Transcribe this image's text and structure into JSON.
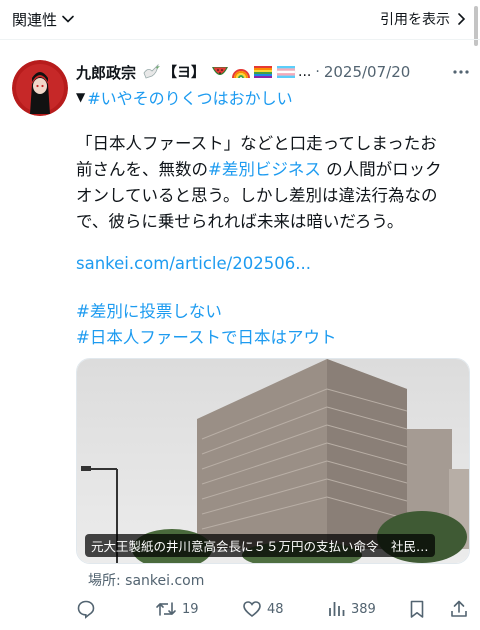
{
  "top_bar": {
    "sort_label": "関連性",
    "view_quotes_label": "引用を表示"
  },
  "tweet": {
    "author_name": "九郎政宗",
    "badge_text": "【ヨ】",
    "name_truncation": "...",
    "date_separator": "·",
    "date": "2025/07/20",
    "bio_marker": "▼",
    "bio_hashtag": "#いやそのりくつはおかしい",
    "body_before": "「日本人ファースト」などと口走ってしまったお\n前さんを、無数の",
    "body_hashtag": "#差別ビジネス",
    "body_after": " の人間がロック\nオンしていると思う。しかし差別は違法行為なの\nで、彼らに乗せられれば未来は暗いだろう。",
    "link": "sankei.com/article/202506...",
    "tag_line_1": "#差別に投票しない",
    "tag_line_2": "#日本人ファーストで日本はアウト",
    "card_caption": "元大王製紙の井川意高会長に５５万円の支払い命令　社民…",
    "card_source": "場所: sankei.com"
  },
  "actions": {
    "retweets": "19",
    "likes": "48",
    "views": "389"
  },
  "icons": {
    "sort": "chevron-down-icon",
    "view_quotes": "chevron-right-icon",
    "more": "more-dots-icon",
    "reply": "reply-icon",
    "retweet": "retweet-icon",
    "like": "heart-icon",
    "views": "analytics-icon",
    "bookmark": "bookmark-icon",
    "share": "share-icon"
  },
  "colors": {
    "accent": "#1d9bf0",
    "text": "#0f1419",
    "secondary": "#536471"
  }
}
